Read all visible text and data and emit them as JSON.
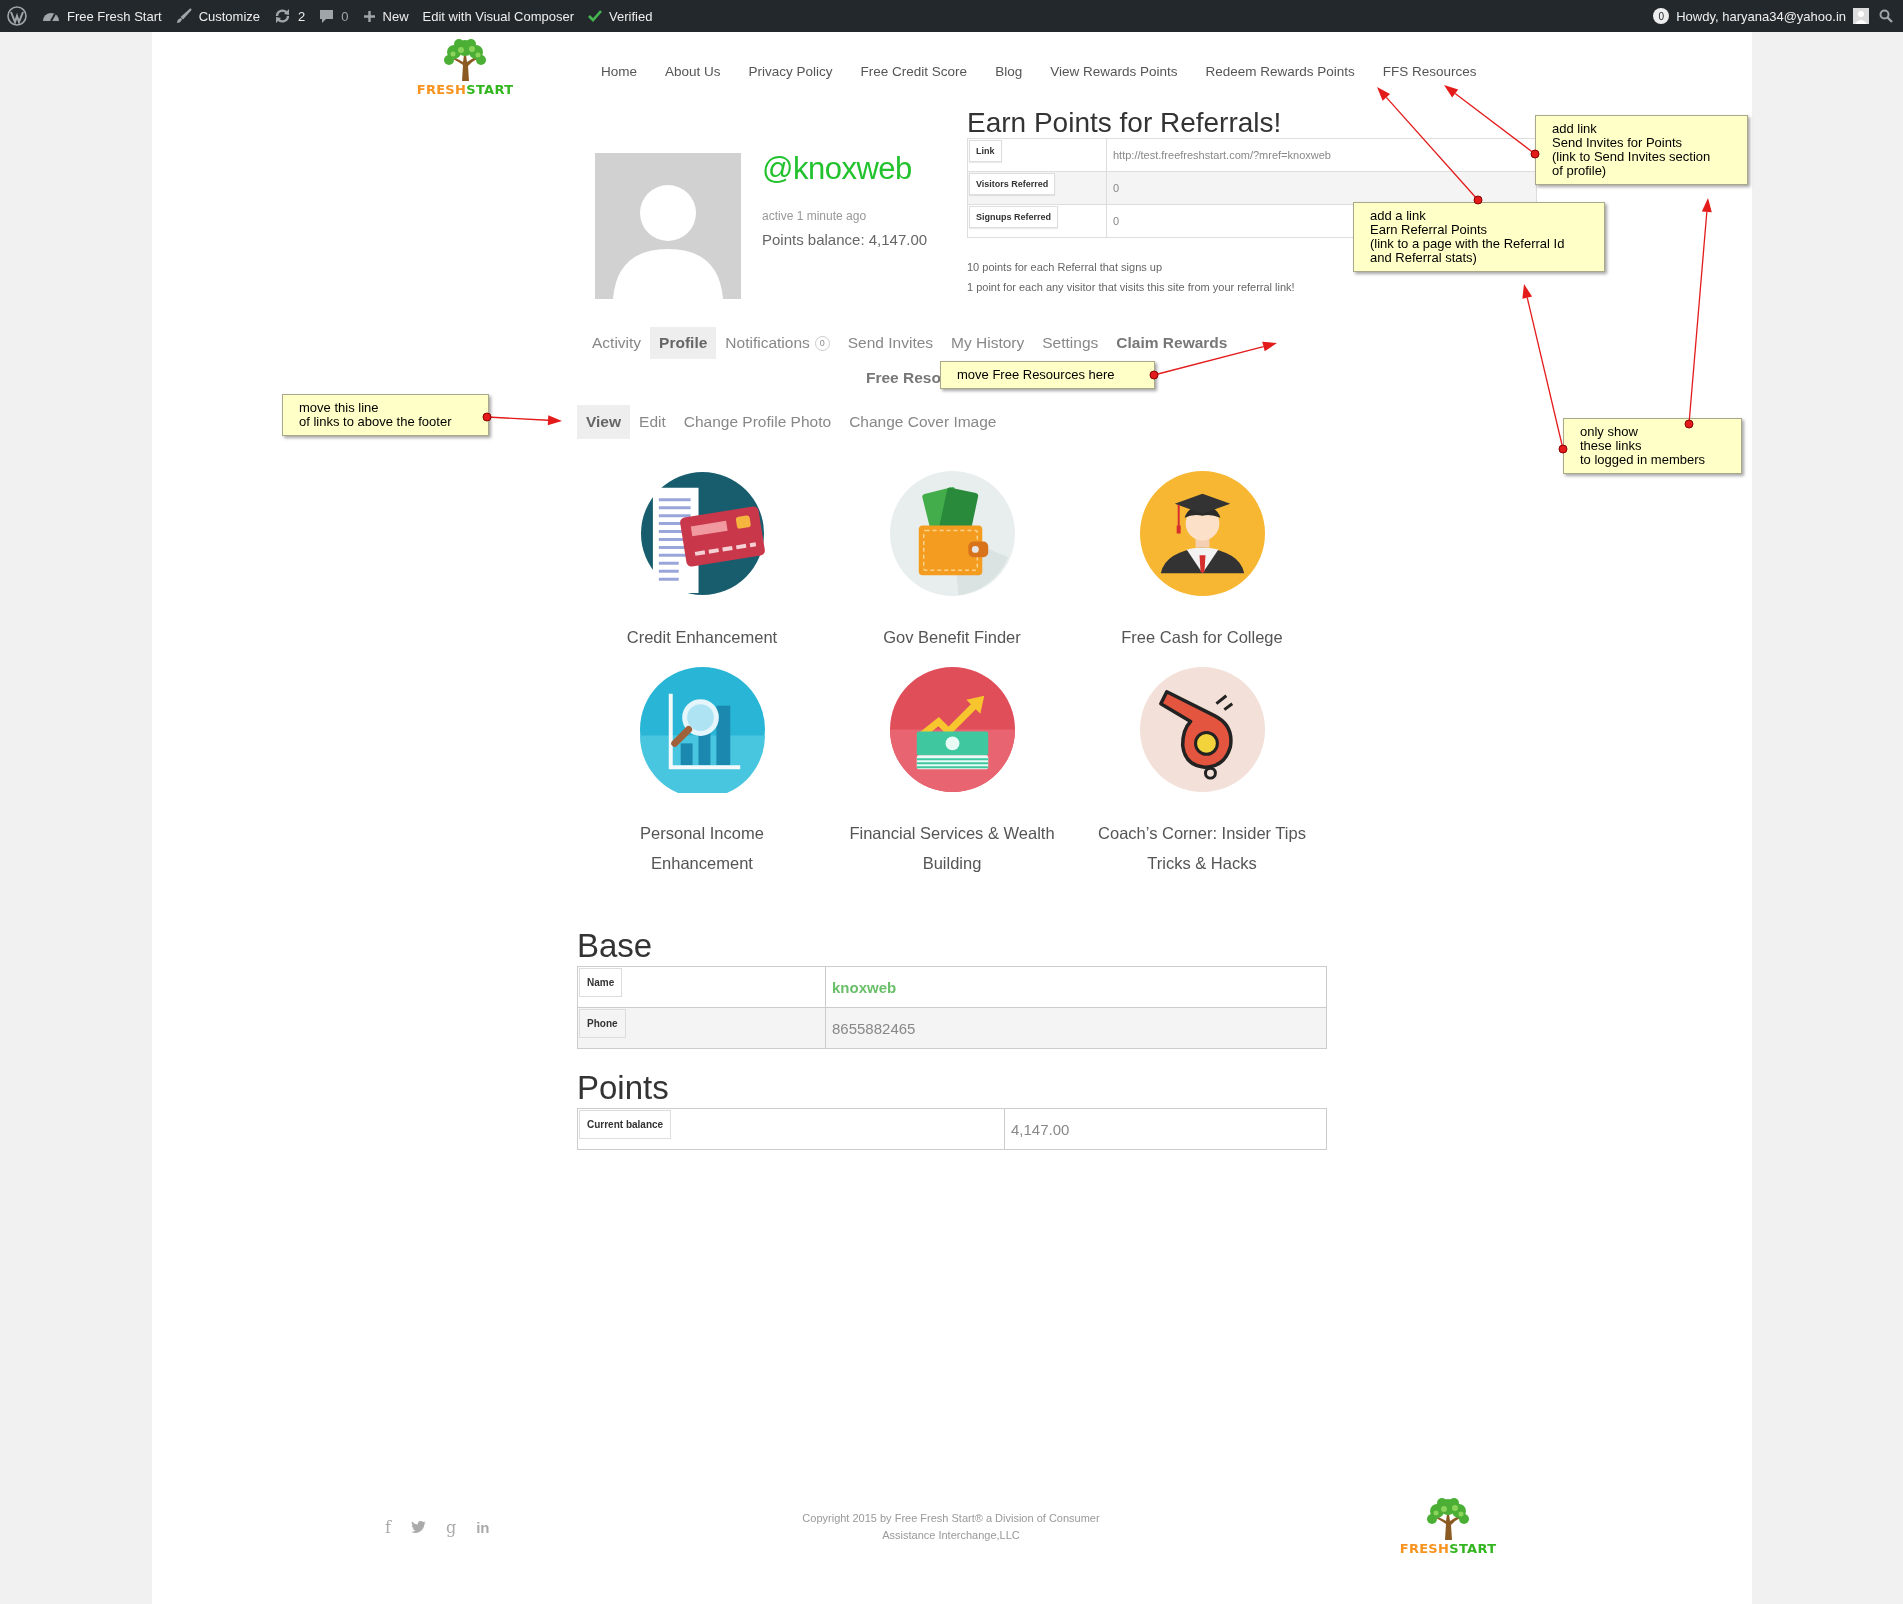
{
  "admin_bar": {
    "items": [
      {
        "kind": "wordpress"
      },
      {
        "kind": "dashboard",
        "label": "Free Fresh Start"
      },
      {
        "kind": "brush",
        "label": "Customize"
      },
      {
        "kind": "updates",
        "label": "2"
      },
      {
        "kind": "comments",
        "label": "0"
      },
      {
        "kind": "new",
        "label": "New"
      },
      {
        "kind": "plain",
        "label": "Edit with Visual Composer"
      },
      {
        "kind": "check",
        "label": "Verified"
      }
    ],
    "notification_count": "0",
    "greeting": "Howdy, haryana34@yahoo.in"
  },
  "header": {
    "logo": {
      "first": "FRESH",
      "second": "START"
    },
    "nav": [
      "Home",
      "About Us",
      "Privacy Policy",
      "Free Credit Score",
      "Blog",
      "View Rewards Points",
      "Redeem Rewards Points",
      "FFS Resources"
    ]
  },
  "profile": {
    "username": "@knoxweb",
    "last_active": "active 1 minute ago",
    "points_balance": "Points balance: 4,147.00"
  },
  "referrals": {
    "title": "Earn Points for Referrals!",
    "rows": [
      {
        "label": "Link",
        "value": "http://test.freefreshstart.com/?mref=knoxweb"
      },
      {
        "label": "Visitors Referred",
        "value": "0"
      },
      {
        "label": "Signups Referred",
        "value": "0"
      }
    ],
    "notes": [
      "10 points for each Referral that signs up",
      "1 point for each any visitor that visits this site from your referral link!"
    ]
  },
  "tabs": [
    {
      "label": "Activity",
      "selected": false,
      "kind": "plain"
    },
    {
      "label": "Profile",
      "selected": true,
      "kind": "plain"
    },
    {
      "label": "Notifications",
      "selected": false,
      "kind": "plain",
      "count": "0"
    },
    {
      "label": "Send Invites",
      "selected": false,
      "kind": "plain"
    },
    {
      "label": "My History",
      "selected": false,
      "kind": "plain"
    },
    {
      "label": "Settings",
      "selected": false,
      "kind": "plain"
    },
    {
      "label": "Claim Rewards",
      "selected": false,
      "kind": "emphasized"
    },
    {
      "label": "Free Reso",
      "selected": false,
      "kind": "emphasized"
    }
  ],
  "subnav": [
    {
      "label": "View",
      "selected": true
    },
    {
      "label": "Edit",
      "selected": false
    },
    {
      "label": "Change Profile Photo",
      "selected": false
    },
    {
      "label": "Change Cover Image",
      "selected": false
    }
  ],
  "services": [
    {
      "kind": "credit-card",
      "label": "Credit Enhancement"
    },
    {
      "kind": "wallet",
      "label": "Gov Benefit Finder"
    },
    {
      "kind": "graduate",
      "label": "Free Cash for College"
    },
    {
      "kind": "chart",
      "label": "Personal Income Enhancement"
    },
    {
      "kind": "money",
      "label": "Financial Services & Wealth Building"
    },
    {
      "kind": "whistle",
      "label": "Coach’s Corner: Insider Tips Tricks & Hacks"
    }
  ],
  "sections": [
    {
      "title": "Base",
      "rows": [
        {
          "label": "Name",
          "value": "knoxweb",
          "kind": "link"
        },
        {
          "label": "Phone",
          "value": "8655882465",
          "kind": "text"
        }
      ]
    },
    {
      "title": "Points",
      "rows": [
        {
          "label": "Current balance",
          "value": "4,147.00",
          "kind": "text"
        }
      ]
    }
  ],
  "footer": {
    "social": [
      {
        "kind": "facebook",
        "glyph": "f"
      },
      {
        "kind": "twitter"
      },
      {
        "kind": "google",
        "glyph": "g"
      },
      {
        "kind": "linkedin",
        "glyph": "in"
      }
    ],
    "copyright": "Copyright 2015 by Free Fresh Start® a Division of Consumer Assistance Interchange,LLC",
    "logo": {
      "first": "FRESH",
      "second": "START"
    }
  },
  "annotations": [
    {
      "text": "add link\nSend Invites for Points\n(link to Send Invites section\nof profile)"
    },
    {
      "text": "add a link\nEarn Referral Points\n(link to a page with the Referral Id\nand Referral stats)"
    },
    {
      "text": "move Free Resources here"
    },
    {
      "text": "move this line\nof links to above the footer"
    },
    {
      "text": "only show\nthese links\nto logged in members"
    }
  ]
}
